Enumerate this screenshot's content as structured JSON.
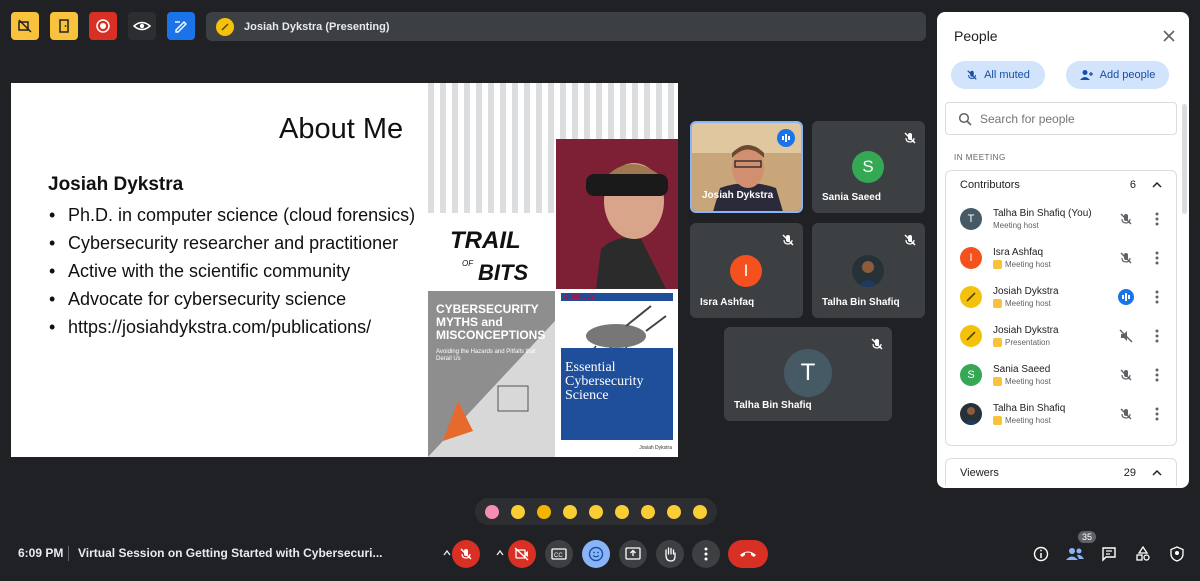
{
  "topbar": {
    "presenting_label": "Josiah Dykstra (Presenting)"
  },
  "slide": {
    "title": "About Me",
    "name": "Josiah Dykstra",
    "bullets": [
      "Ph.D. in computer science (cloud forensics)",
      "Cybersecurity researcher and practitioner",
      "Active with the scientific community",
      "Advocate for cybersecurity science",
      "https://josiahdykstra.com/publications/"
    ],
    "logo_text": "TRAIL OF BITS",
    "book1_title": "CYBERSECURITY MYTHS and MISCONCEPTIONS",
    "book1_subtitle": "Avoiding the Hazards and Pitfalls that Derail Us",
    "book2_publisher": "O'REILLY",
    "book2_title": "Essential Cybersecurity Science",
    "book2_author": "Josiah Dykstra"
  },
  "tiles": [
    {
      "name": "Josiah Dykstra",
      "initial": ""
    },
    {
      "name": "Sania Saeed",
      "initial": "S",
      "color": "#34a853"
    },
    {
      "name": "Isra Ashfaq",
      "initial": "I",
      "color": "#f4511e"
    },
    {
      "name": "Talha Bin Shafiq",
      "initial": ""
    },
    {
      "name": "Talha Bin Shafiq",
      "initial": "T",
      "color": "#455a64"
    }
  ],
  "bottombar": {
    "time": "6:09 PM",
    "meeting_title": "Virtual Session on Getting Started with Cybersecuri...",
    "participant_count": "35"
  },
  "people_panel": {
    "title": "People",
    "all_muted_label": "All muted",
    "add_people_label": "Add people",
    "search_placeholder": "Search for people",
    "in_meeting_label": "IN MEETING",
    "contributors_label": "Contributors",
    "contributors_count": "6",
    "viewers_label": "Viewers",
    "viewers_count": "29",
    "people": [
      {
        "name": "Talha Bin Shafiq (You)",
        "role": "Meeting host",
        "initial": "T",
        "color": "#455a64"
      },
      {
        "name": "Isra Ashfaq",
        "role": "Meeting host",
        "initial": "I",
        "color": "#f4511e"
      },
      {
        "name": "Josiah Dykstra",
        "role": "Meeting host",
        "initial": "",
        "color": "#f4c20d"
      },
      {
        "name": "Josiah Dykstra",
        "role": "Presentation",
        "initial": "",
        "color": "#f4c20d"
      },
      {
        "name": "Sania Saeed",
        "role": "Meeting host",
        "initial": "S",
        "color": "#34a853"
      },
      {
        "name": "Talha Bin Shafiq",
        "role": "Meeting host",
        "initial": "",
        "color": "#263238"
      }
    ]
  }
}
